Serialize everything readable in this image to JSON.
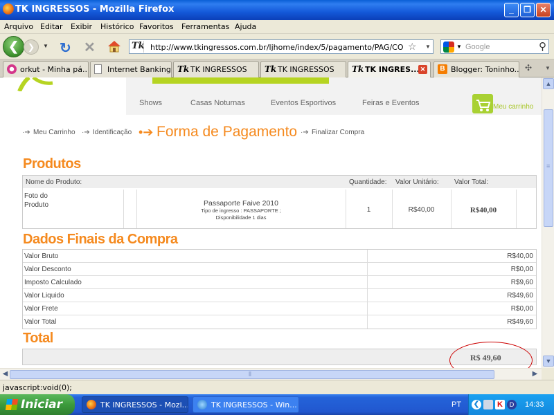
{
  "window": {
    "title": "TK INGRESSOS - Mozilla Firefox",
    "min_symbol": "_",
    "max_symbol": "❐",
    "close_symbol": "✕"
  },
  "menubar": {
    "items": [
      "Arquivo",
      "Editar",
      "Exibir",
      "Histórico",
      "Favoritos",
      "Ferramentas",
      "Ajuda"
    ]
  },
  "navbar": {
    "back_symbol": "❮",
    "forward_symbol": "❯",
    "drop_symbol": "▼",
    "reload_symbol": "↻",
    "stop_symbol": "✕",
    "url": "http://www.tkingressos.com.br/ljhome/index/5/pagamento/PAG/CO",
    "url_favicon": "Tk",
    "bookmark_symbol": "☆",
    "search_placeholder": "Google",
    "search_symbol": "⚲"
  },
  "tabs": [
    {
      "label": "orkut - Minha pá...",
      "icon": "orkut-icon",
      "active": false
    },
    {
      "label": "Internet Banking",
      "icon": "page-icon",
      "active": false
    },
    {
      "label": "TK INGRESSOS",
      "icon": "tk-icon",
      "active": false
    },
    {
      "label": "TK INGRESSOS",
      "icon": "tk-icon",
      "active": false
    },
    {
      "label": "TK INGRES...",
      "icon": "tk-icon",
      "active": true
    },
    {
      "label": "Blogger: Toninho...",
      "icon": "blogger-icon",
      "active": false
    }
  ],
  "tab_icon_text": {
    "tk": "Tk",
    "blogger": "B"
  },
  "tab_close_symbol": "✕",
  "tab_new_symbol": "✣",
  "tab_list_symbol": "▼",
  "site": {
    "nav": [
      "Shows",
      "Casas Noturnas",
      "Eventos Esportivos",
      "Feiras e Eventos"
    ],
    "cart_label": "Meu carrinho",
    "steps": {
      "step1": "Meu Carrinho",
      "step2": "Identificação",
      "step3": "Forma de Pagamento",
      "step4": "Finalizar Compra",
      "small_arrow": "·➔",
      "big_arrow": "•➔"
    },
    "produtos": {
      "title": "Produtos",
      "headers": {
        "name": "Nome do Produto:",
        "qty": "Quantidade:",
        "unit": "Valor Unitário:",
        "total": "Valor Total:"
      },
      "row": {
        "photo_label": "Foto do Produto",
        "product_name": "Passaporte Faive 2010",
        "product_detail_1": "Tipo de ingresso : PASSAPORTE ;",
        "product_detail_2": "Disponibilidade 1 dias",
        "qty": "1",
        "unit": "R$40,00",
        "total": "R$40,00"
      }
    },
    "dados": {
      "title": "Dados Finais da Compra",
      "rows": [
        {
          "label": "Valor Bruto",
          "value": "R$40,00"
        },
        {
          "label": "Valor Desconto",
          "value": "R$0,00"
        },
        {
          "label": "Imposto Calculado",
          "value": "R$9,60"
        },
        {
          "label": "Valor Liquido",
          "value": "R$49,60"
        },
        {
          "label": "Valor Frete",
          "value": "R$0,00"
        },
        {
          "label": "Valor Total",
          "value": "R$49,60"
        }
      ]
    },
    "total": {
      "title": "Total",
      "value": "R$ 49,60"
    }
  },
  "scroll": {
    "up": "▲",
    "down": "▼",
    "left": "◀",
    "right": "▶",
    "grip": "≡",
    "hgrip": "⦀"
  },
  "statusbar": {
    "text": "javascript:void(0);"
  },
  "taskbar": {
    "start_label": "Iniciar",
    "buttons": [
      {
        "label": "TK INGRESSOS - Mozi...",
        "active": true
      },
      {
        "label": "TK INGRESSOS - Win...",
        "active": false
      }
    ],
    "language": "PT",
    "tray_chevron": "❮",
    "tray_k": "K",
    "tray_d": "D",
    "clock": "14:33"
  },
  "colors": {
    "accent_orange": "#f58a1f",
    "brand_green": "#b6d422",
    "annotation_red": "#cc0000"
  }
}
